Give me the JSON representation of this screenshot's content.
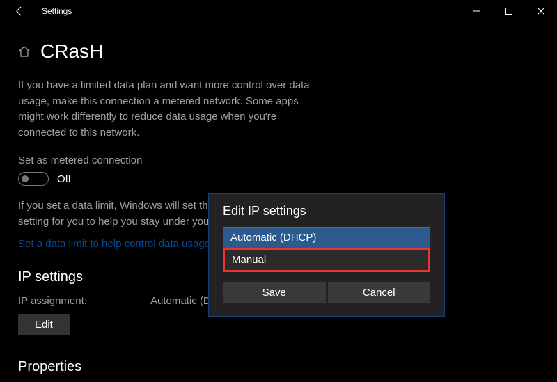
{
  "window": {
    "title": "Settings"
  },
  "page": {
    "name": "CRasH",
    "metered_description": "If you have a limited data plan and want more control over data usage, make this connection a metered network. Some apps might work differently to reduce data usage when you're connected to this network.",
    "metered_label": "Set as metered connection",
    "toggle_state": "Off",
    "limit_text": "If you set a data limit, Windows will set the metered connection setting for you to help you stay under your",
    "limit_link": "Set a data limit to help control data usage o",
    "ip_section": "IP settings",
    "ip_assignment_label": "IP assignment:",
    "ip_assignment_value": "Automatic (DHC",
    "edit_label": "Edit",
    "properties_section": "Properties"
  },
  "dialog": {
    "title": "Edit IP settings",
    "option_auto": "Automatic (DHCP)",
    "option_manual": "Manual",
    "save_label": "Save",
    "cancel_label": "Cancel"
  }
}
